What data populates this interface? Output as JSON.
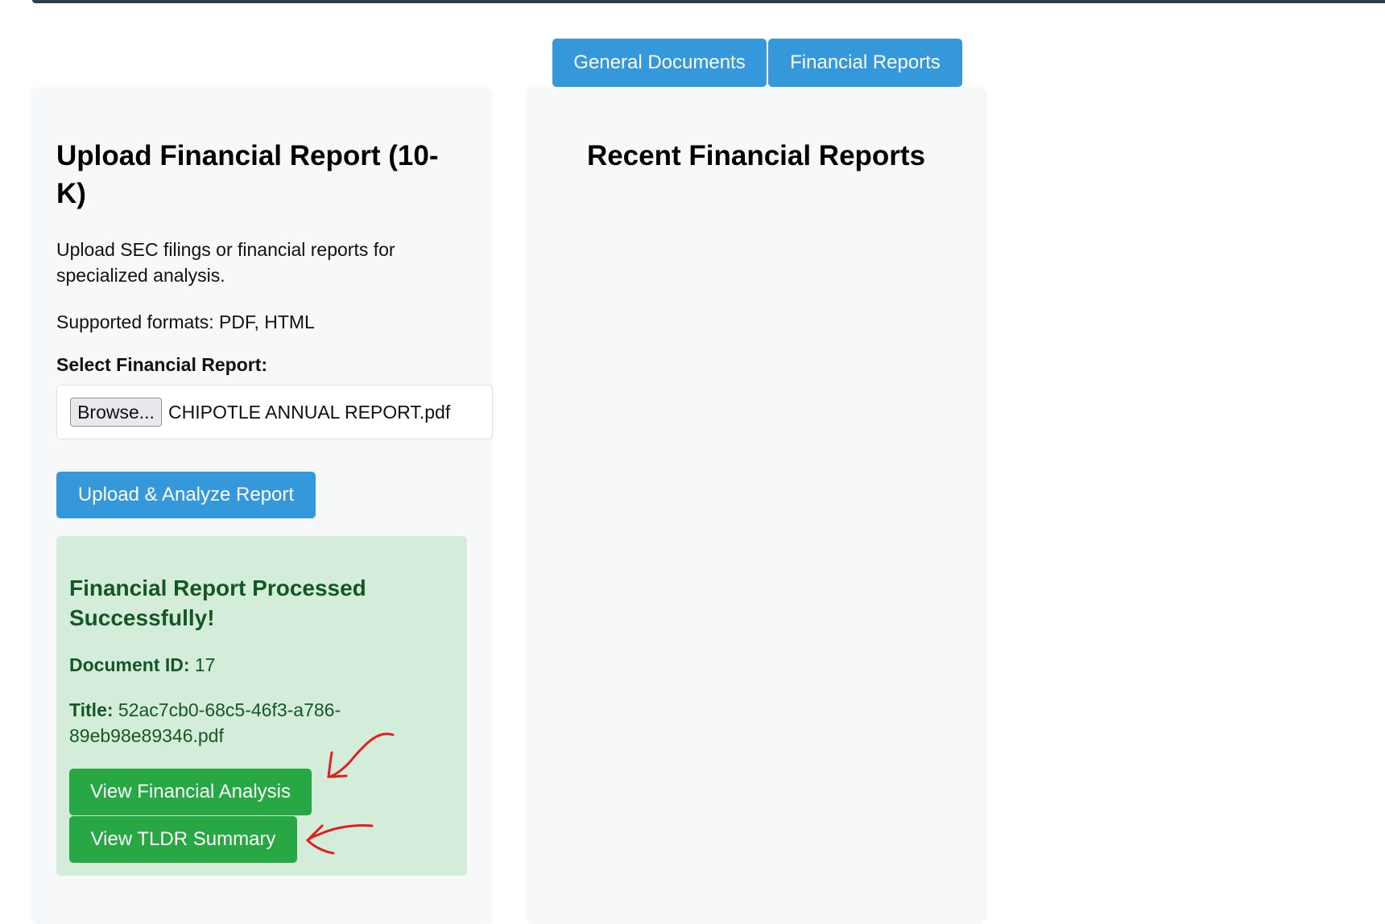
{
  "tabs": [
    {
      "label": "General Documents"
    },
    {
      "label": "Financial Reports"
    }
  ],
  "upload_panel": {
    "title": "Upload Financial Report (10-K)",
    "description": "Upload SEC filings or financial reports for specialized analysis.",
    "formats": "Supported formats: PDF, HTML",
    "select_label": "Select Financial Report:",
    "browse_label": "Browse...",
    "file_name": "CHIPOTLE ANNUAL REPORT.pdf",
    "upload_button": "Upload & Analyze Report"
  },
  "success": {
    "heading": "Financial Report Processed Successfully!",
    "doc_id_label": "Document ID:",
    "doc_id_value": "17",
    "title_label": "Title:",
    "title_value": "52ac7cb0-68c5-46f3-a786-89eb98e89346.pdf",
    "analysis_button": "View Financial Analysis",
    "tldr_button": "View TLDR Summary"
  },
  "recent_panel": {
    "title": "Recent Financial Reports"
  },
  "colors": {
    "tab_blue": "#3498db",
    "success_bg": "#d4eddb",
    "success_text": "#155724",
    "green_button": "#28a745",
    "annotation_red": "#e02020"
  }
}
